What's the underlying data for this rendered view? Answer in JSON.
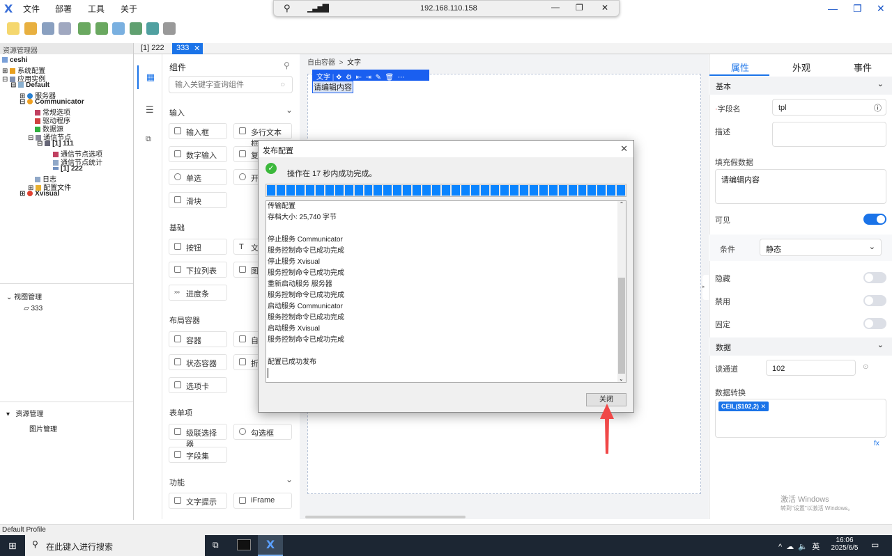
{
  "menu": {
    "items": [
      "文件",
      "部署",
      "工具",
      "关于"
    ]
  },
  "remote": {
    "address": "192.168.110.158"
  },
  "doc_tabs": [
    {
      "label": "[1] 222",
      "active": false
    },
    {
      "label": "333",
      "active": true
    }
  ],
  "resource_manager": {
    "title": "资源管理器",
    "tree": [
      "ceshi",
      "系统配置",
      "应用实例",
      "Default",
      "服务器",
      "Communicator",
      "常规选项",
      "驱动程序",
      "数据源",
      "通信节点",
      "[1] 111",
      "通信节点选项",
      "通信节点统计",
      "[1] 222",
      "日志",
      "配置文件",
      "Xvisual"
    ]
  },
  "view_manager": {
    "title": "视图管理",
    "items": [
      "333"
    ]
  },
  "asset_manager": {
    "title": "资源管理",
    "items": [
      "图片管理"
    ]
  },
  "components": {
    "title": "组件",
    "search_placeholder": "输入关键字查询组件",
    "groups": [
      {
        "name": "输入",
        "items": [
          "输入框",
          "多行文本框",
          "数字输入",
          "复",
          "单选",
          "开",
          "滑块"
        ]
      },
      {
        "name": "基础",
        "items": [
          "按钮",
          "文",
          "下拉列表",
          "图",
          "进度条"
        ]
      },
      {
        "name": "布局容器",
        "items": [
          "容器",
          "自",
          "状态容器",
          "折",
          "选项卡"
        ]
      },
      {
        "name": "表单项",
        "items": [
          "级联选择器",
          "勾选框",
          "字段集"
        ]
      },
      {
        "name": "功能",
        "items": [
          "文字提示",
          "iFrame"
        ]
      }
    ]
  },
  "canvas": {
    "breadcrumb": [
      "自由容器",
      ">",
      "文字"
    ],
    "selected_label": "文字",
    "text_content": "请编辑内容"
  },
  "properties": {
    "tabs": [
      "属性",
      "外观",
      "事件"
    ],
    "active_tab": "属性",
    "basic": {
      "title": "基本",
      "field_name_label": "字段名",
      "field_name": "tpl",
      "desc_label": "描述",
      "desc": "",
      "fill_label": "填充假数据",
      "fill": "请编辑内容",
      "visible_label": "可见",
      "visible": true,
      "condition_label": "条件",
      "condition": "静态",
      "hidden_label": "隐藏",
      "hidden": false,
      "disabled_label": "禁用",
      "disabled": false,
      "fixed_label": "固定",
      "fixed": false
    },
    "data": {
      "title": "数据",
      "channel_label": "读通道",
      "channel": "102",
      "transform_label": "数据转换",
      "transform_tag": "CEIL($102,2)"
    }
  },
  "dialog": {
    "title": "发布配置",
    "message": "操作在 17 秒内成功完成。",
    "progress": 100,
    "log": [
      "传输配置",
      "存档大小: 25,740 字节",
      "",
      "停止服务 Communicator",
      "服务控制命令已成功完成",
      "停止服务 Xvisual",
      "服务控制命令已成功完成",
      "重新启动服务 服务器",
      "服务控制命令已成功完成",
      "启动服务 Communicator",
      "服务控制命令已成功完成",
      "启动服务 Xvisual",
      "服务控制命令已成功完成",
      "",
      "配置已成功发布"
    ],
    "close_label": "关闭"
  },
  "status_bar": {
    "text": "Default Profile"
  },
  "watermark": {
    "line1": "激活 Windows",
    "line2": "转到\"设置\"以激活 Windows。"
  },
  "taskbar": {
    "search_placeholder": "在此键入进行搜索",
    "ime": "英",
    "time": "16:06",
    "date": "2025/6/5"
  }
}
